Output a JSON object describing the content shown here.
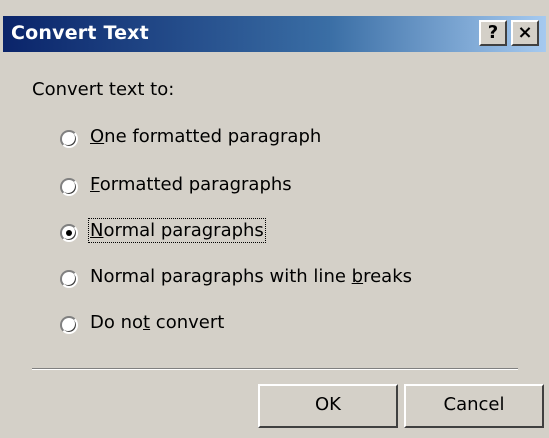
{
  "window": {
    "title": "Convert Text",
    "help_button": "?",
    "close_button": "×"
  },
  "group": {
    "label": "Convert text to:"
  },
  "options": [
    {
      "pre": "",
      "accel": "O",
      "post": "ne formatted paragraph",
      "checked": false
    },
    {
      "pre": "",
      "accel": "F",
      "post": "ormatted paragraphs",
      "checked": false
    },
    {
      "pre": "",
      "accel": "N",
      "post": "ormal paragraphs",
      "checked": true
    },
    {
      "pre": "Normal paragraphs with line ",
      "accel": "b",
      "post": "reaks",
      "checked": false
    },
    {
      "pre": "Do no",
      "accel": "t",
      "post": " convert",
      "checked": false
    }
  ],
  "buttons": {
    "ok": "OK",
    "cancel": "Cancel"
  }
}
